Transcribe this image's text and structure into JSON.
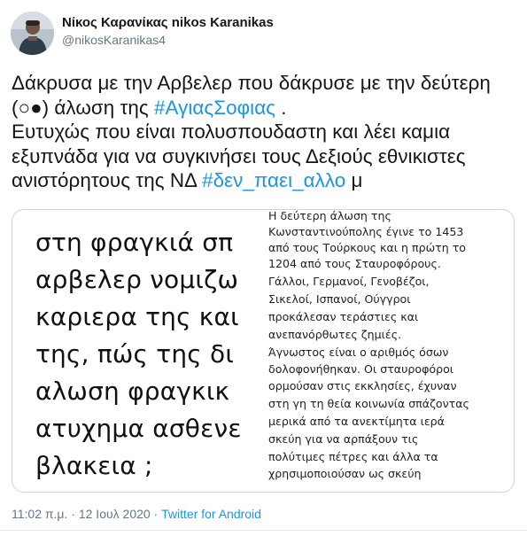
{
  "author": {
    "display_name": "Νίκος Καρανίκας nikos Karanikas",
    "handle": "@nikosKaranikas4"
  },
  "tweet": {
    "line1": "Δάκρυσα με την Αρβελερ που δάκρυσε με την δεύτερη",
    "line2_prefix": "(○●) άλωση της ",
    "hashtag1": "#ΑγιαςΣοφιας",
    "line2_suffix": " .",
    "line3": "Ευτυχώς που είναι πολυσπουδαστη και λέει καμια",
    "line4": "εξυπνάδα για να συγκινήσει τους Δεξιούς εθνικιστες",
    "line5_prefix": "ανιστόρητους της ΝΔ ",
    "hashtag2": "#δεν_παει_αλλο",
    "line5_suffix": "  μ"
  },
  "media": {
    "left_lines": [
      "στη φραγκιά σπ",
      "αρβελερ νομιζω",
      "καριερα της και",
      "της, πώς της δι",
      "αλωση φραγκικ",
      "ατυχημα ασθενε",
      "βλακεια ;"
    ],
    "right_lines": [
      "Η δεύτερη άλωση της",
      "Κωνσταντινούπολης έγινε το 1453",
      "από τους Τούρκους και η πρώτη το",
      "1204 από τους Σταυροφόρους.",
      "Γάλλοι, Γερμανοί, Γενοβέζοι,",
      "Σικελοί, Ισπανοί, Ούγγροι",
      "προκάλεσαν τεράστιες και",
      "ανεπανόρθωτες ζημιές.",
      "Άγνωστος είναι ο αριθμός όσων",
      "δολοφονήθηκαν. Οι σταυροφόροι",
      "ορμούσαν στις εκκλησίες, έχυναν",
      "στη γη τη θεία κοινωνία σπάζοντας",
      "μερικά από τα ανεκτίμητα ιερά",
      "σκεύη για να αρπάξουν τις",
      "πολύτιμες πέτρες και άλλα τα",
      "χρησιμοποιούσαν ως σκεύη"
    ]
  },
  "footer": {
    "time": "11:02 π.μ.",
    "separator1": " · ",
    "date": "12 Ιουλ 2020",
    "separator2": " · ",
    "client": "Twitter for Android"
  },
  "colors": {
    "link": "#1b95e0",
    "secondary_text": "#657786",
    "primary_text": "#14171a",
    "border": "#ccd6dd"
  }
}
